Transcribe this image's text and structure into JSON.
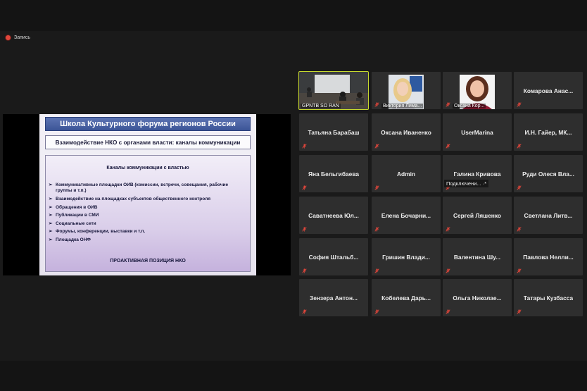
{
  "recording": {
    "label": "Запись"
  },
  "slide": {
    "title": "Школа Культурного форума регионов России",
    "subtitle": "Взаимодействие НКО с органами власти: каналы коммуникации",
    "box_heading": "Каналы коммуникации с властью",
    "items": [
      "Коммуникативные площадки ОИВ (комиссии, встречи, совещания, рабочие группы и т.п.)",
      "Взаимодействие на площадках субъектов общественного контроля",
      "Обращения в ОИВ",
      "Публикации в СМИ",
      "Социальные сети",
      "Форумы, конференции, выставки и т.п.",
      "Площадка ОНФ"
    ],
    "footer": "ПРОАКТИВНАЯ ПОЗИЦИЯ НКО"
  },
  "participants": [
    {
      "name": "GPNTB SO RAN",
      "video": "room",
      "active": true
    },
    {
      "name": "Виктория Лима...",
      "video": "woman-blonde"
    },
    {
      "name": "Оксана Кор...",
      "video": "woman-dark"
    },
    {
      "name": "Комарова Анас..."
    },
    {
      "name": "Татьяна Барабаш"
    },
    {
      "name": "Оксана Иваненко"
    },
    {
      "name": "UserMarina"
    },
    {
      "name": "И.Н. Гайер, МК..."
    },
    {
      "name": "Яна Бельгибаева"
    },
    {
      "name": "Admin"
    },
    {
      "name": "Галина Кривова",
      "status": "Подключени... ·*"
    },
    {
      "name": "Руди Олеся Вла..."
    },
    {
      "name": "Саватнеева Юл..."
    },
    {
      "name": "Елена Бочарни..."
    },
    {
      "name": "Сергей Ляшенко"
    },
    {
      "name": "Светлана Литв..."
    },
    {
      "name": "София Штальб..."
    },
    {
      "name": "Гришин Влади..."
    },
    {
      "name": "Валентина Шу..."
    },
    {
      "name": "Павлова Нелли..."
    },
    {
      "name": "Зензера Антон..."
    },
    {
      "name": "Кобелева Дарь..."
    },
    {
      "name": "Ольга Николае..."
    },
    {
      "name": "Татары Кузбасса"
    }
  ],
  "icons": {
    "muted": "mic-muted-icon",
    "record": "record-icon"
  },
  "colors": {
    "active_speaker": "#c7d92e",
    "muted": "#e0463b",
    "tile": "#2e2e2e",
    "slide_title": "#3c5597"
  }
}
